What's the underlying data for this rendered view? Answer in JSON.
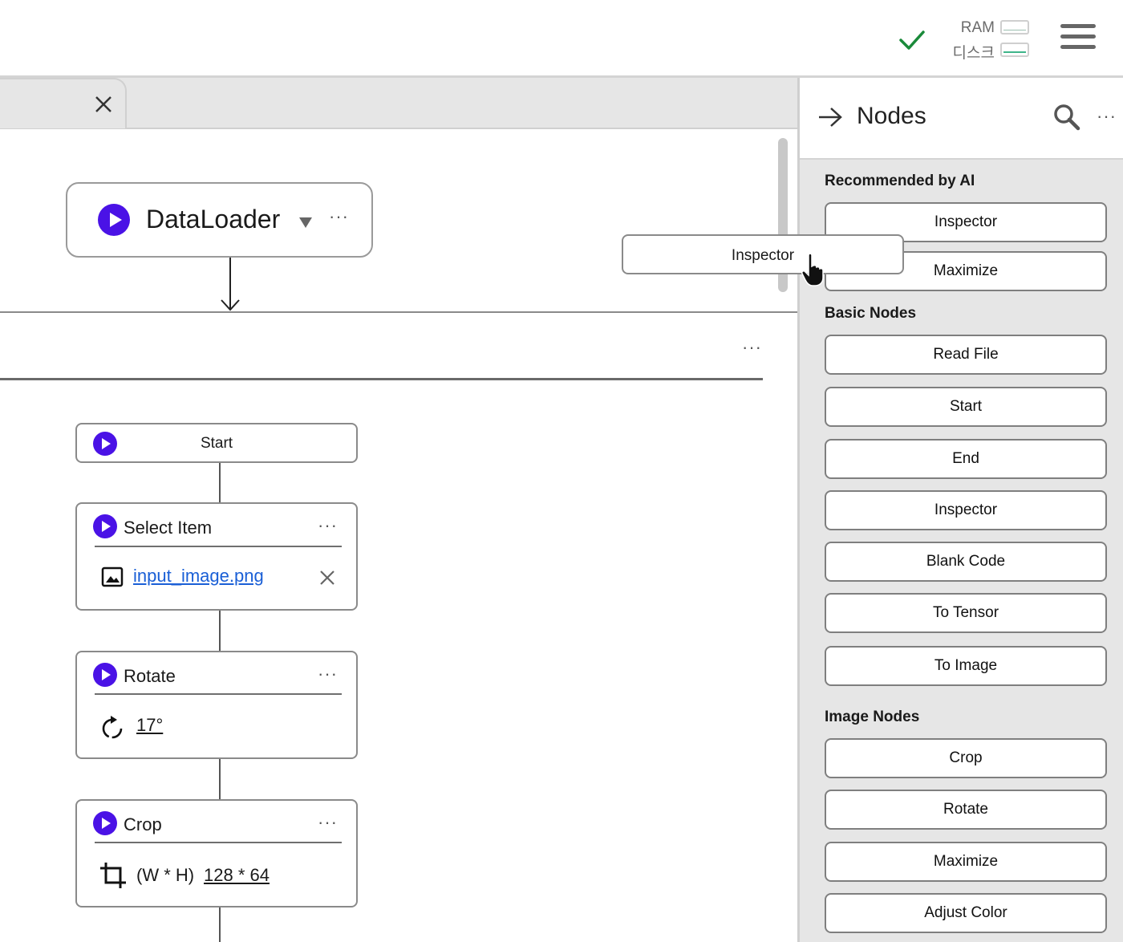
{
  "topbar": {
    "status_icon": "check-icon",
    "ram_label": "RAM",
    "disk_label": "디스크",
    "menu_icon": "hamburger-icon",
    "accent_check": "#1a8a3a"
  },
  "tab": {
    "close_icon": "close-icon"
  },
  "canvas": {
    "dataloader": {
      "label": "DataLoader",
      "dropdown_icon": "caret-down-icon",
      "more": "···"
    },
    "group_more": "···",
    "nodes": {
      "start": {
        "label": "Start"
      },
      "select_item": {
        "label": "Select Item",
        "more": "···",
        "file": "input_image.png"
      },
      "rotate": {
        "label": "Rotate",
        "more": "···",
        "value": "17°"
      },
      "crop": {
        "label": "Crop",
        "more": "···",
        "prefix": "(W * H)",
        "value": "128 * 64"
      }
    },
    "drag_ghost": {
      "label": "Inspector"
    }
  },
  "panel": {
    "title": "Nodes",
    "more": "···",
    "sections": {
      "recommended": {
        "title": "Recommended by AI",
        "items": [
          "Inspector",
          "Maximize"
        ]
      },
      "basic": {
        "title": "Basic Nodes",
        "items": [
          "Read File",
          "Start",
          "End",
          "Inspector",
          "Blank Code",
          "To Tensor",
          "To Image"
        ]
      },
      "image": {
        "title": "Image Nodes",
        "items": [
          "Crop",
          "Rotate",
          "Maximize",
          "Adjust Color"
        ]
      }
    }
  },
  "colors": {
    "play": "#4a12e6",
    "link": "#1a5fd6"
  }
}
